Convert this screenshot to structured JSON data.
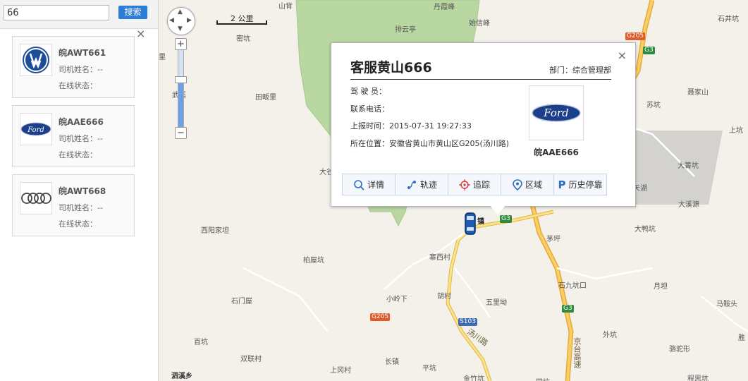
{
  "search": {
    "value": "66",
    "button_label": "搜索"
  },
  "panel": {
    "close_glyph": "×"
  },
  "vehicles": [
    {
      "plate": "皖AWT661",
      "driver": "司机姓名：--",
      "online": "在线状态：",
      "brand": "volkswagen"
    },
    {
      "plate": "皖AAE666",
      "driver": "司机姓名：--",
      "online": "在线状态：",
      "brand": "ford"
    },
    {
      "plate": "皖AWT668",
      "driver": "司机姓名：--",
      "online": "在线状态：",
      "brand": "audi"
    }
  ],
  "map": {
    "scale_label": "2 公里",
    "zoom_in": "+",
    "zoom_out": "−",
    "places": [
      "山背",
      "丹霞峰",
      "始信峰",
      "排云亭",
      "密坑",
      "武溪",
      "田畈里",
      "大谷",
      "西阳家坦",
      "柏屋坑",
      "石门屋",
      "百坑",
      "双联村",
      "泗溪乡",
      "寨西村",
      "小岭下",
      "胡村",
      "五里坳",
      "长镇",
      "上冈村",
      "平坑",
      "金竹坑",
      "石井坑",
      "聂家山",
      "苏坑",
      "上坑",
      "大箐坑",
      "天湖",
      "大溪源",
      "大鸭坑",
      "茅坪",
      "石九坑口",
      "月坦",
      "马鞍头",
      "外坑",
      "骆驼形",
      "胜",
      "程思坑",
      "同坑",
      "镇",
      "里"
    ],
    "shields": {
      "g205": "G205",
      "g3": "G3",
      "s103": "S103"
    },
    "road_labels": {
      "jingtai": "京台高速",
      "tangchuan": "汤川路"
    }
  },
  "popup": {
    "title": "客服黄山666",
    "dept": "部门：综合管理部",
    "driver": "驾 驶 员：",
    "phone": "联系电话：",
    "report_time": "上报时间：2015-07-31 19:27:33",
    "location": "所在位置：安徽省黄山市黄山区G205(汤川路)",
    "plate": "皖AAE666",
    "close_glyph": "×",
    "actions": [
      "详情",
      "轨迹",
      "追踪",
      "区域",
      "历史停靠"
    ]
  },
  "colors": {
    "accent": "#2c7dd6",
    "highway": "#f5c14d",
    "park_green": "#b8d8a0",
    "map_bg": "#f3f1ea"
  }
}
